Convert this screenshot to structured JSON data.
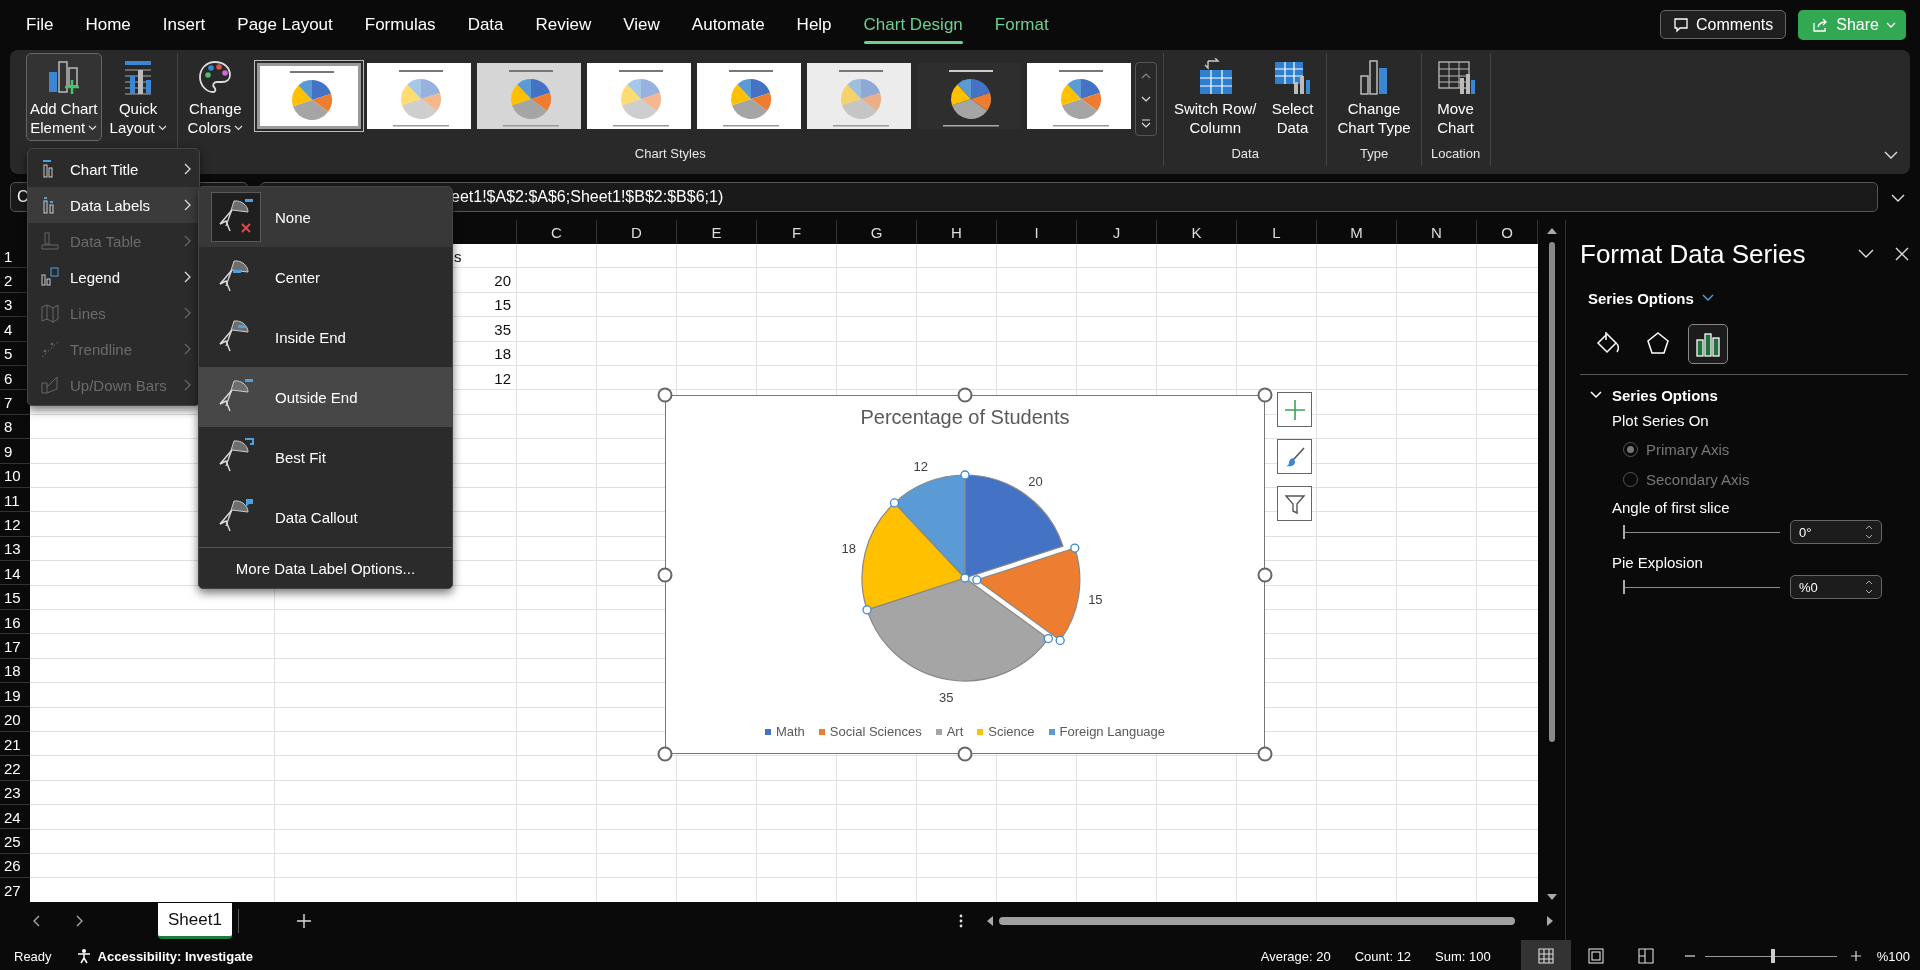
{
  "ribbon_tabs": [
    {
      "label": "File",
      "selected": false,
      "contextual": false
    },
    {
      "label": "Home",
      "selected": false,
      "contextual": false
    },
    {
      "label": "Insert",
      "selected": false,
      "contextual": false
    },
    {
      "label": "Page Layout",
      "selected": false,
      "contextual": false
    },
    {
      "label": "Formulas",
      "selected": false,
      "contextual": false
    },
    {
      "label": "Data",
      "selected": false,
      "contextual": false
    },
    {
      "label": "Review",
      "selected": false,
      "contextual": false
    },
    {
      "label": "View",
      "selected": false,
      "contextual": false
    },
    {
      "label": "Automate",
      "selected": false,
      "contextual": false
    },
    {
      "label": "Help",
      "selected": false,
      "contextual": false
    },
    {
      "label": "Chart Design",
      "selected": true,
      "contextual": true
    },
    {
      "label": "Format",
      "selected": false,
      "contextual": true
    }
  ],
  "comments_button": {
    "label": "Comments"
  },
  "share_button": {
    "label": "Share"
  },
  "ribbon": {
    "groups": [
      {
        "buttons": [
          {
            "kind": "add-element",
            "lines": [
              "Add Chart",
              "Element"
            ],
            "dropdown": true,
            "pressed": true
          },
          {
            "kind": "quick-layout",
            "lines": [
              "Quick",
              "Layout"
            ],
            "dropdown": true,
            "pressed": false
          }
        ]
      },
      {
        "label": "Chart Styles",
        "buttons": [
          {
            "kind": "palette",
            "lines": [
              "Change",
              "Colors"
            ],
            "dropdown": true,
            "pressed": false
          }
        ],
        "gallery": [
          {
            "selected": true
          },
          {
            "selected": false
          },
          {
            "selected": false
          },
          {
            "selected": false
          },
          {
            "selected": false
          },
          {
            "selected": false
          },
          {
            "selected": false
          },
          {
            "selected": false
          }
        ]
      },
      {
        "label": "Data",
        "buttons": [
          {
            "kind": "switch",
            "lines": [
              "Switch Row/",
              "Column"
            ],
            "dropdown": false,
            "pressed": false
          },
          {
            "kind": "select-data",
            "lines": [
              "Select",
              "Data"
            ],
            "dropdown": false,
            "pressed": false
          }
        ]
      },
      {
        "label": "Type",
        "buttons": [
          {
            "kind": "chart-type",
            "lines": [
              "Change",
              "Chart Type"
            ],
            "dropdown": false,
            "pressed": false
          }
        ]
      },
      {
        "label": "Location",
        "buttons": [
          {
            "kind": "move-chart",
            "lines": [
              "Move",
              "Chart"
            ],
            "dropdown": false,
            "pressed": false
          }
        ]
      }
    ]
  },
  "formula_bar": {
    "name_box": "C",
    "formula": "eet1!$A$2:$A$6;Sheet1!$B$2:$B$6;1)"
  },
  "sheet": {
    "columns": [
      "C",
      "D",
      "E",
      "F",
      "G",
      "H",
      "I",
      "J",
      "K",
      "L",
      "M",
      "N",
      "O"
    ],
    "rows": [
      {
        "label": "1",
        "b": {
          "text": "s",
          "cut": true
        }
      },
      {
        "label": "2",
        "b": {
          "text": "20",
          "cut": false
        }
      },
      {
        "label": "3",
        "b": {
          "text": "15",
          "cut": false
        }
      },
      {
        "label": "4",
        "b": {
          "text": "35",
          "cut": false
        }
      },
      {
        "label": "5",
        "b": {
          "text": "18",
          "cut": false
        }
      },
      {
        "label": "6",
        "b": {
          "text": "12",
          "cut": false
        }
      },
      {
        "label": "7"
      },
      {
        "label": "8"
      },
      {
        "label": "9"
      },
      {
        "label": "10"
      },
      {
        "label": "11"
      },
      {
        "label": "12"
      },
      {
        "label": "13"
      },
      {
        "label": "14"
      },
      {
        "label": "15"
      },
      {
        "label": "16"
      },
      {
        "label": "17"
      },
      {
        "label": "18"
      },
      {
        "label": "19"
      },
      {
        "label": "20"
      },
      {
        "label": "21"
      },
      {
        "label": "22"
      },
      {
        "label": "23"
      },
      {
        "label": "24"
      },
      {
        "label": "25"
      },
      {
        "label": "26"
      },
      {
        "label": "27"
      }
    ]
  },
  "chart": {
    "chart_data": {
      "type": "pie",
      "title": "Percentage of Students",
      "categories": [
        "Math",
        "Social Sciences",
        "Art",
        "Science",
        "Foreign Language"
      ],
      "values": [
        20,
        15,
        35,
        18,
        12
      ],
      "data_labels": true,
      "legend": "bottom"
    },
    "slices": [
      {
        "color": "#4472c4",
        "exploded": false
      },
      {
        "color": "#ed7d31",
        "exploded": true
      },
      {
        "color": "#a5a5a5",
        "exploded": false
      },
      {
        "color": "#ffc000",
        "exploded": false
      },
      {
        "color": "#5b9bd5",
        "exploded": false
      }
    ],
    "side_buttons": [
      {
        "kind": "plus"
      },
      {
        "kind": "brush"
      },
      {
        "kind": "filter"
      }
    ]
  },
  "chart_element_menu": {
    "items": [
      {
        "kind": "chart-title",
        "label": "Chart Title",
        "disabled": false,
        "hovered": false
      },
      {
        "kind": "data-labels",
        "label": "Data Labels",
        "disabled": false,
        "hovered": true
      },
      {
        "kind": "data-table",
        "label": "Data Table",
        "disabled": true,
        "hovered": false
      },
      {
        "kind": "legend",
        "label": "Legend",
        "disabled": false,
        "hovered": false
      },
      {
        "kind": "lines",
        "label": "Lines",
        "disabled": true,
        "hovered": false
      },
      {
        "kind": "trendline",
        "label": "Trendline",
        "disabled": true,
        "hovered": false
      },
      {
        "kind": "updown",
        "label": "Up/Down Bars",
        "disabled": true,
        "hovered": false
      }
    ]
  },
  "data_labels_menu": {
    "items": [
      {
        "kind": "none",
        "label": "None",
        "selected": true,
        "hovered": false
      },
      {
        "kind": "center",
        "label": "Center",
        "selected": false,
        "hovered": false
      },
      {
        "kind": "inside-end",
        "label": "Inside End",
        "selected": false,
        "hovered": false
      },
      {
        "kind": "outside-end",
        "label": "Outside End",
        "selected": false,
        "hovered": true
      },
      {
        "kind": "best-fit",
        "label": "Best Fit",
        "selected": false,
        "hovered": false
      },
      {
        "kind": "callout",
        "label": "Data Callout",
        "selected": false,
        "hovered": false
      }
    ],
    "more_options": "More Data Label Options..."
  },
  "pane": {
    "title": "Format Data Series",
    "options_dropdown": "Series Options",
    "icon_tabs": [
      {
        "kind": "fill",
        "selected": false
      },
      {
        "kind": "effects",
        "selected": false
      },
      {
        "kind": "series",
        "selected": true
      }
    ],
    "section": {
      "title": "Series Options",
      "expanded": true,
      "plot_label": "Plot Series On",
      "radios": [
        {
          "label": "Primary Axis",
          "selected": true,
          "disabled": true
        },
        {
          "label": "Secondary Axis",
          "selected": false,
          "disabled": true
        }
      ],
      "sliders": [
        {
          "label": "Angle of first slice",
          "level": 0,
          "value": "0°"
        },
        {
          "label": "Pie Explosion",
          "level": 0,
          "value": "%0"
        }
      ]
    }
  },
  "sheet_tabs": [
    {
      "label": "Sheet1",
      "selected": true
    }
  ],
  "status_bar": {
    "ready": "Ready",
    "accessibility": "Accessibility: Investigate",
    "stats": [
      "Average: 20",
      "Count: 12",
      "Sum: 100"
    ],
    "views": [
      {
        "kind": "normal",
        "selected": true
      },
      {
        "kind": "page-layout",
        "selected": false
      },
      {
        "kind": "page-break",
        "selected": false
      }
    ],
    "zoom": {
      "level": 0.5,
      "value": "%100"
    }
  }
}
